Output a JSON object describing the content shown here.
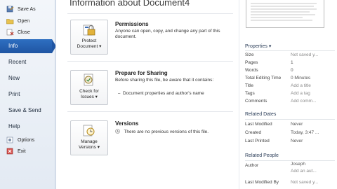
{
  "sidebar": {
    "save_as": "Save As",
    "open": "Open",
    "close": "Close",
    "info": "Info",
    "recent": "Recent",
    "new": "New",
    "print": "Print",
    "save_send": "Save & Send",
    "help": "Help",
    "options": "Options",
    "exit": "Exit"
  },
  "main": {
    "title": "Information about Document4",
    "permissions": {
      "button_line1": "Protect",
      "button_line2": "Document",
      "heading": "Permissions",
      "text": "Anyone can open, copy, and change any part of this document."
    },
    "sharing": {
      "button_line1": "Check for",
      "button_line2": "Issues",
      "heading": "Prepare for Sharing",
      "text": "Before sharing this file, be aware that it contains:",
      "bullet": "Document properties and author's name"
    },
    "versions": {
      "button_line1": "Manage",
      "button_line2": "Versions",
      "heading": "Versions",
      "text": "There are no previous versions of this file."
    }
  },
  "properties": {
    "header": "Properties",
    "rows": [
      {
        "label": "Size",
        "value": "Not saved y..."
      },
      {
        "label": "Pages",
        "value": "1"
      },
      {
        "label": "Words",
        "value": "0"
      },
      {
        "label": "Total Editing Time",
        "value": "0 Minutes"
      },
      {
        "label": "Title",
        "value": "Add a title"
      },
      {
        "label": "Tags",
        "value": "Add a tag"
      },
      {
        "label": "Comments",
        "value": "Add comm..."
      }
    ],
    "related_dates_header": "Related Dates",
    "dates": [
      {
        "label": "Last Modified",
        "value": "Never"
      },
      {
        "label": "Created",
        "value": "Today, 3:47 ..."
      },
      {
        "label": "Last Printed",
        "value": "Never"
      }
    ],
    "related_people_header": "Related People",
    "author_label": "Author",
    "author_value": "Joseph",
    "add_author": "Add an aut...",
    "last_modified_by_label": "Last Modified By",
    "last_modified_by_value": "Not saved y..."
  }
}
